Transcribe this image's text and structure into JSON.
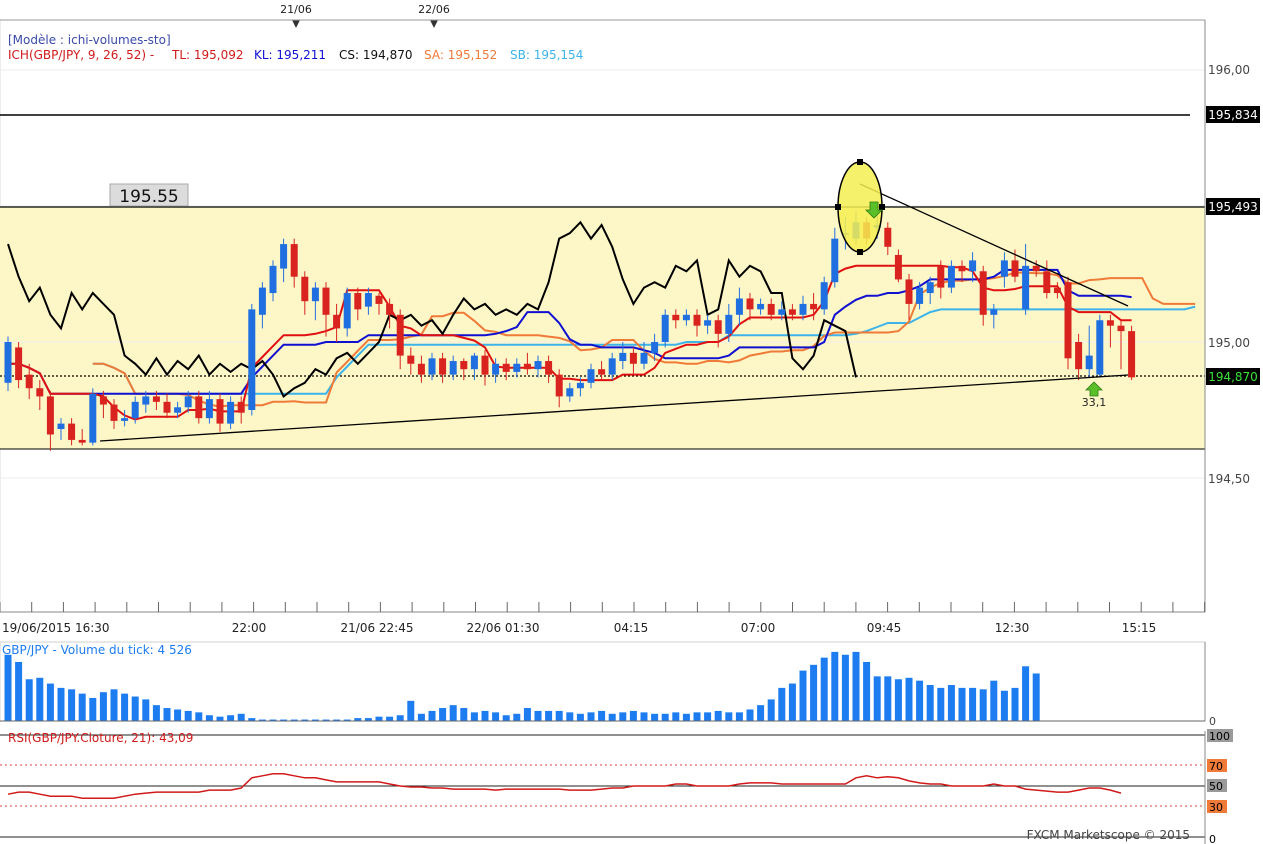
{
  "header": {
    "template_label": "[Modèle : ichi-volumes-sto]",
    "ich_label": "ICH(GBP/JPY, 9, 26, 52) -",
    "tl": "TL: 195,092",
    "kl": "KL: 195,211",
    "cs": "CS: 194,870",
    "sa": "SA: 195,152",
    "sb": "SB: 195,154"
  },
  "top_markers": [
    "21/06",
    "22/06"
  ],
  "level_label": "195.55",
  "price_axis": {
    "ticks": [
      "196,00",
      "195,00",
      "194,50"
    ],
    "tags": [
      {
        "text": "195,834",
        "kind": "black"
      },
      {
        "text": "195,493",
        "kind": "black"
      },
      {
        "text": "194,870",
        "kind": "green"
      }
    ]
  },
  "time_axis": [
    "19/06/2015 16:30",
    "22:00",
    "21/06 22:45",
    "22/06 01:30",
    "04:15",
    "07:00",
    "09:45",
    "12:30",
    "15:15"
  ],
  "volume_label": "GBP/JPY - Volume du tick: 4 526",
  "volume_axis": [
    "0"
  ],
  "rsi_label": "RSI(GBP/JPY.Cloture, 21): 43,09",
  "rsi_axis": [
    "100",
    "70",
    "50",
    "30",
    "0"
  ],
  "annotation": "33,1",
  "footer": "FXCM Marketscope © 2015",
  "colors": {
    "bull": "#1f6fe0",
    "bear": "#d8231e",
    "tenkan": "#e01010",
    "kijun": "#1010d0",
    "senkou_a": "#f07a38",
    "senkou_b": "#3cb4ea",
    "chikou": "#000000",
    "range_fill": "#fdf7c8",
    "volume": "#1c7cf0",
    "rsi": "#d11a1a"
  },
  "chart_data": {
    "type": "candlestick",
    "title": "ICH(GBP/JPY, 9, 26, 52)",
    "ylim": [
      194.2,
      196.2
    ],
    "y_ticks": [
      196.0,
      195.5,
      195.0,
      194.5
    ],
    "levels": [
      195.834,
      195.493,
      194.87,
      194.62
    ],
    "candles": [
      [
        194.85,
        195.0,
        194.82,
        195.02
      ],
      [
        194.98,
        194.86,
        194.83,
        195.0
      ],
      [
        194.88,
        194.83,
        194.79,
        194.92
      ],
      [
        194.83,
        194.8,
        194.75,
        194.86
      ],
      [
        194.8,
        194.66,
        194.6,
        194.82
      ],
      [
        194.68,
        194.7,
        194.64,
        194.72
      ],
      [
        194.7,
        194.64,
        194.62,
        194.72
      ],
      [
        194.64,
        194.63,
        194.62,
        194.68
      ],
      [
        194.63,
        194.81,
        194.62,
        194.83
      ],
      [
        194.8,
        194.77,
        194.72,
        194.82
      ],
      [
        194.77,
        194.71,
        194.68,
        194.79
      ],
      [
        194.71,
        194.72,
        194.69,
        194.75
      ],
      [
        194.72,
        194.78,
        194.7,
        194.8
      ],
      [
        194.77,
        194.8,
        194.74,
        194.82
      ],
      [
        194.8,
        194.78,
        194.75,
        194.82
      ],
      [
        194.78,
        194.74,
        194.72,
        194.81
      ],
      [
        194.74,
        194.76,
        194.72,
        194.78
      ],
      [
        194.76,
        194.8,
        194.74,
        194.82
      ],
      [
        194.8,
        194.72,
        194.7,
        194.82
      ],
      [
        194.72,
        194.79,
        194.7,
        194.82
      ],
      [
        194.79,
        194.7,
        194.67,
        194.81
      ],
      [
        194.7,
        194.78,
        194.68,
        194.8
      ],
      [
        194.78,
        194.74,
        194.7,
        194.8
      ],
      [
        194.75,
        195.12,
        194.73,
        195.14
      ],
      [
        195.1,
        195.2,
        195.05,
        195.22
      ],
      [
        195.18,
        195.28,
        195.15,
        195.3
      ],
      [
        195.27,
        195.36,
        195.22,
        195.38
      ],
      [
        195.36,
        195.24,
        195.2,
        195.38
      ],
      [
        195.24,
        195.15,
        195.1,
        195.26
      ],
      [
        195.15,
        195.2,
        195.08,
        195.22
      ],
      [
        195.2,
        195.1,
        195.02,
        195.22
      ],
      [
        195.1,
        195.05,
        195.0,
        195.14
      ],
      [
        195.05,
        195.18,
        195.02,
        195.2
      ],
      [
        195.18,
        195.12,
        195.08,
        195.2
      ],
      [
        195.13,
        195.18,
        195.1,
        195.2
      ],
      [
        195.17,
        195.14,
        195.1,
        195.18
      ],
      [
        195.14,
        195.1,
        195.05,
        195.16
      ],
      [
        195.1,
        194.95,
        194.9,
        195.12
      ],
      [
        194.95,
        194.92,
        194.88,
        194.98
      ],
      [
        194.92,
        194.88,
        194.85,
        194.95
      ],
      [
        194.88,
        194.94,
        194.86,
        194.96
      ],
      [
        194.94,
        194.88,
        194.85,
        194.96
      ],
      [
        194.88,
        194.93,
        194.86,
        194.95
      ],
      [
        194.93,
        194.9,
        194.86,
        194.94
      ],
      [
        194.9,
        194.95,
        194.86,
        194.96
      ],
      [
        194.95,
        194.88,
        194.84,
        194.97
      ],
      [
        194.88,
        194.92,
        194.85,
        194.94
      ],
      [
        194.92,
        194.89,
        194.86,
        194.94
      ],
      [
        194.89,
        194.92,
        194.87,
        194.94
      ],
      [
        194.92,
        194.9,
        194.88,
        194.96
      ],
      [
        194.9,
        194.93,
        194.87,
        194.95
      ],
      [
        194.93,
        194.88,
        194.85,
        194.95
      ],
      [
        194.88,
        194.8,
        194.76,
        194.9
      ],
      [
        194.8,
        194.83,
        194.78,
        194.85
      ],
      [
        194.83,
        194.85,
        194.8,
        194.87
      ],
      [
        194.85,
        194.9,
        194.83,
        194.92
      ],
      [
        194.9,
        194.88,
        194.86,
        194.93
      ],
      [
        194.88,
        194.94,
        194.86,
        194.96
      ],
      [
        194.93,
        194.96,
        194.9,
        195.0
      ],
      [
        194.96,
        194.92,
        194.88,
        194.98
      ],
      [
        194.92,
        194.96,
        194.9,
        195.0
      ],
      [
        194.96,
        195.0,
        194.93,
        195.03
      ],
      [
        195.0,
        195.1,
        194.98,
        195.12
      ],
      [
        195.1,
        195.08,
        195.05,
        195.12
      ],
      [
        195.08,
        195.1,
        195.06,
        195.12
      ],
      [
        195.1,
        195.06,
        195.02,
        195.12
      ],
      [
        195.06,
        195.08,
        195.03,
        195.1
      ],
      [
        195.08,
        195.03,
        194.98,
        195.1
      ],
      [
        195.03,
        195.1,
        195.0,
        195.14
      ],
      [
        195.1,
        195.16,
        195.06,
        195.2
      ],
      [
        195.16,
        195.12,
        195.08,
        195.18
      ],
      [
        195.12,
        195.14,
        195.1,
        195.16
      ],
      [
        195.14,
        195.1,
        195.08,
        195.16
      ],
      [
        195.1,
        195.12,
        195.08,
        195.15
      ],
      [
        195.12,
        195.1,
        195.08,
        195.14
      ],
      [
        195.1,
        195.14,
        195.08,
        195.17
      ],
      [
        195.14,
        195.12,
        195.08,
        195.18
      ],
      [
        195.12,
        195.22,
        195.1,
        195.24
      ],
      [
        195.22,
        195.38,
        195.2,
        195.42
      ],
      [
        195.4,
        195.4,
        195.34,
        195.46
      ],
      [
        195.38,
        195.44,
        195.36,
        195.48
      ],
      [
        195.44,
        195.38,
        195.36,
        195.46
      ],
      [
        195.42,
        195.43,
        195.38,
        195.47
      ],
      [
        195.42,
        195.35,
        195.32,
        195.44
      ],
      [
        195.32,
        195.23,
        195.22,
        195.34
      ],
      [
        195.23,
        195.14,
        195.08,
        195.25
      ],
      [
        195.14,
        195.2,
        195.12,
        195.22
      ],
      [
        195.18,
        195.22,
        195.14,
        195.24
      ],
      [
        195.28,
        195.2,
        195.16,
        195.3
      ],
      [
        195.2,
        195.28,
        195.18,
        195.3
      ],
      [
        195.28,
        195.26,
        195.22,
        195.3
      ],
      [
        195.26,
        195.3,
        195.22,
        195.33
      ],
      [
        195.26,
        195.1,
        195.06,
        195.28
      ],
      [
        195.1,
        195.12,
        195.05,
        195.14
      ],
      [
        195.24,
        195.3,
        195.2,
        195.33
      ],
      [
        195.3,
        195.24,
        195.22,
        195.34
      ],
      [
        195.12,
        195.28,
        195.1,
        195.36
      ],
      [
        195.28,
        195.26,
        195.24,
        195.3
      ],
      [
        195.26,
        195.18,
        195.16,
        195.3
      ],
      [
        195.2,
        195.18,
        195.16,
        195.22
      ],
      [
        195.22,
        194.94,
        194.9,
        195.24
      ],
      [
        195.0,
        194.9,
        194.86,
        195.03
      ],
      [
        194.9,
        194.95,
        194.87,
        195.06
      ],
      [
        194.88,
        195.08,
        194.87,
        195.1
      ],
      [
        195.08,
        195.06,
        194.98,
        195.1
      ],
      [
        195.06,
        195.04,
        194.9,
        195.08
      ],
      [
        195.04,
        194.87,
        194.86,
        195.06
      ]
    ],
    "volume": {
      "label": "Volume du tick",
      "values": [
        92,
        82,
        58,
        60,
        52,
        46,
        44,
        38,
        32,
        40,
        44,
        38,
        34,
        30,
        22,
        18,
        16,
        14,
        12,
        8,
        6,
        8,
        10,
        4,
        2,
        2,
        2,
        2,
        2,
        2,
        2,
        2,
        2,
        4,
        4,
        6,
        6,
        8,
        28,
        10,
        14,
        18,
        22,
        18,
        12,
        14,
        12,
        8,
        10,
        18,
        14,
        14,
        14,
        12,
        10,
        12,
        14,
        10,
        12,
        14,
        12,
        10,
        10,
        12,
        10,
        12,
        12,
        14,
        12,
        12,
        16,
        22,
        30,
        46,
        52,
        70,
        78,
        88,
        96,
        92,
        96,
        82,
        62,
        62,
        58,
        60,
        56,
        50,
        46,
        50,
        46,
        46,
        44,
        56,
        42,
        46,
        76,
        66
      ]
    },
    "rsi": {
      "label": "RSI(GBP/JPY.Cloture, 21)",
      "ylim": [
        0,
        100
      ],
      "levels": [
        70,
        50,
        30
      ],
      "values": [
        42,
        44,
        44,
        42,
        40,
        40,
        40,
        38,
        38,
        38,
        38,
        40,
        42,
        43,
        44,
        44,
        44,
        44,
        44,
        46,
        46,
        46,
        48,
        58,
        60,
        62,
        62,
        60,
        58,
        58,
        56,
        54,
        54,
        54,
        54,
        54,
        52,
        50,
        49,
        49,
        48,
        48,
        47,
        47,
        47,
        47,
        46,
        47,
        47,
        47,
        47,
        47,
        47,
        46,
        46,
        46,
        47,
        48,
        48,
        50,
        50,
        50,
        50,
        52,
        52,
        50,
        50,
        50,
        50,
        52,
        53,
        53,
        53,
        52,
        52,
        52,
        52,
        52,
        52,
        52,
        58,
        60,
        58,
        59,
        58,
        55,
        53,
        52,
        52,
        50,
        50,
        50,
        50,
        52,
        50,
        50,
        47,
        46,
        45,
        44,
        44,
        46,
        48,
        48,
        46,
        43
      ]
    }
  }
}
